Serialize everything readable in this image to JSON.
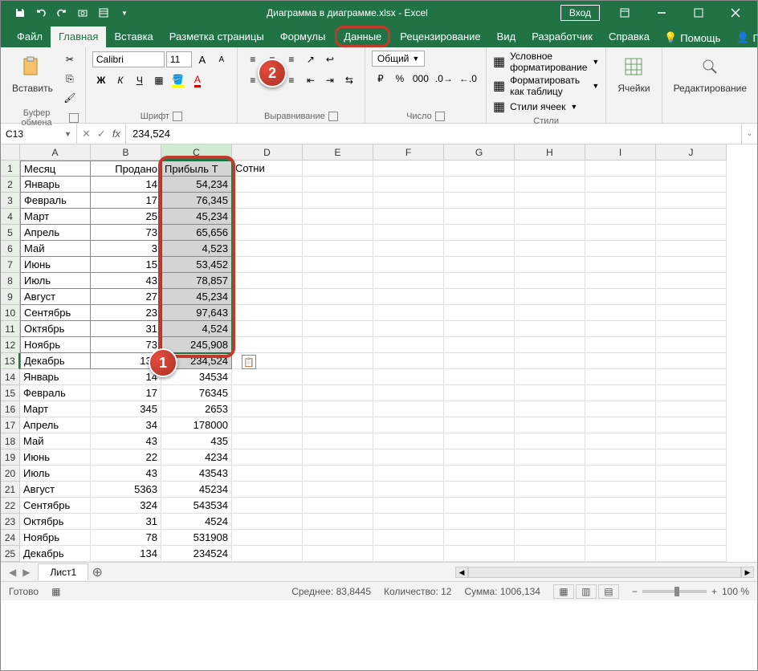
{
  "titlebar": {
    "title": "Диаграмма в диаграмме.xlsx - Excel",
    "login": "Вход"
  },
  "tabs": {
    "items": [
      "Файл",
      "Главная",
      "Вставка",
      "Разметка страницы",
      "Формулы",
      "Данные",
      "Рецензирование",
      "Вид",
      "Разработчик",
      "Справка"
    ],
    "active_index": 1,
    "highlight_index": 5,
    "tell": "Помощь",
    "share": "Поделиться"
  },
  "ribbon": {
    "paste_label": "Вставить",
    "clipboard_label": "Буфер обмена",
    "font_name": "Calibri",
    "font_size": "11",
    "font_label": "Шрифт",
    "align_label": "Выравнивание",
    "number_format": "Общий",
    "number_label": "Число",
    "cond_fmt": "Условное форматирование",
    "fmt_table": "Форматировать как таблицу",
    "cell_styles": "Стили ячеек",
    "styles_label": "Стили",
    "cells_label": "Ячейки",
    "editing_label": "Редактирование"
  },
  "formula": {
    "namebox": "C13",
    "value": "234,524"
  },
  "columns": [
    "A",
    "B",
    "C",
    "D",
    "E",
    "F",
    "G",
    "H",
    "I",
    "J"
  ],
  "headers": {
    "a": "Месяц",
    "b": "Продано",
    "c": "Прибыль Т",
    "d": "Сотни"
  },
  "rows": [
    {
      "n": 1
    },
    {
      "n": 2,
      "a": "Январь",
      "b": "14",
      "c": "54,234"
    },
    {
      "n": 3,
      "a": "Февраль",
      "b": "17",
      "c": "76,345"
    },
    {
      "n": 4,
      "a": "Март",
      "b": "25",
      "c": "45,234"
    },
    {
      "n": 5,
      "a": "Апрель",
      "b": "73",
      "c": "65,656"
    },
    {
      "n": 6,
      "a": "Май",
      "b": "3",
      "c": "4,523"
    },
    {
      "n": 7,
      "a": "Июнь",
      "b": "15",
      "c": "53,452"
    },
    {
      "n": 8,
      "a": "Июль",
      "b": "43",
      "c": "78,857"
    },
    {
      "n": 9,
      "a": "Август",
      "b": "27",
      "c": "45,234"
    },
    {
      "n": 10,
      "a": "Сентябрь",
      "b": "23",
      "c": "97,643"
    },
    {
      "n": 11,
      "a": "Октябрь",
      "b": "31",
      "c": "4,524"
    },
    {
      "n": 12,
      "a": "Ноябрь",
      "b": "73",
      "c": "245,908"
    },
    {
      "n": 13,
      "a": "Декабрь",
      "b": "134",
      "c": "234,524"
    },
    {
      "n": 14,
      "a": "Январь",
      "b": "14",
      "c": "34534"
    },
    {
      "n": 15,
      "a": "Февраль",
      "b": "17",
      "c": "76345"
    },
    {
      "n": 16,
      "a": "Март",
      "b": "345",
      "c": "2653"
    },
    {
      "n": 17,
      "a": "Апрель",
      "b": "34",
      "c": "178000"
    },
    {
      "n": 18,
      "a": "Май",
      "b": "43",
      "c": "435"
    },
    {
      "n": 19,
      "a": "Июнь",
      "b": "22",
      "c": "4234"
    },
    {
      "n": 20,
      "a": "Июль",
      "b": "43",
      "c": "43543"
    },
    {
      "n": 21,
      "a": "Август",
      "b": "5363",
      "c": "45234"
    },
    {
      "n": 22,
      "a": "Сентябрь",
      "b": "324",
      "c": "543534"
    },
    {
      "n": 23,
      "a": "Октябрь",
      "b": "31",
      "c": "4524"
    },
    {
      "n": 24,
      "a": "Ноябрь",
      "b": "78",
      "c": "531908"
    },
    {
      "n": 25,
      "a": "Декабрь",
      "b": "134",
      "c": "234524"
    }
  ],
  "sheet": {
    "name": "Лист1"
  },
  "status": {
    "ready": "Готово",
    "avg_label": "Среднее:",
    "avg_val": "83,8445",
    "count_label": "Количество:",
    "count_val": "12",
    "sum_label": "Сумма:",
    "sum_val": "1006,134",
    "zoom": "100 %"
  },
  "annotations": {
    "badge1": "1",
    "badge2": "2"
  }
}
